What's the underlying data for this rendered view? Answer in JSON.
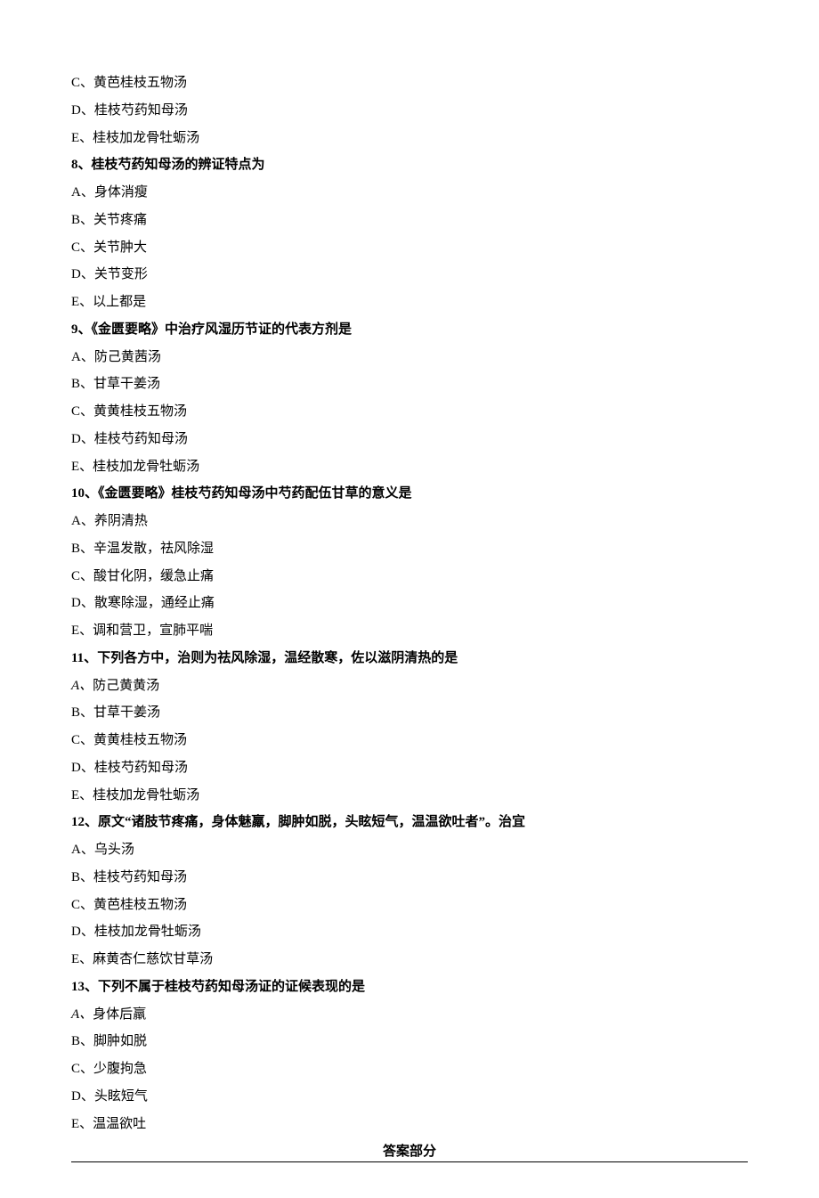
{
  "leading_options": [
    {
      "label": "C、",
      "text": "黄芭桂枝五物汤"
    },
    {
      "label": "D、",
      "text": "桂枝芍药知母汤"
    },
    {
      "label": "E、",
      "text": "桂枝加龙骨牡蛎汤"
    }
  ],
  "questions": [
    {
      "number": "8、",
      "stem": "桂枝芍药知母汤的辨证特点为",
      "options": [
        {
          "label": "A、",
          "text": "身体消瘦"
        },
        {
          "label": "B、",
          "text": "关节疼痛"
        },
        {
          "label": "C、",
          "text": "关节肿大"
        },
        {
          "label": "D、",
          "text": "关节变形"
        },
        {
          "label": "E、",
          "text": "以上都是"
        }
      ]
    },
    {
      "number": "9、",
      "stem": "《金匮要略》中治疗风湿历节证的代表方剂是",
      "options": [
        {
          "label": "A、",
          "text": "防己黄茜汤"
        },
        {
          "label": "B、",
          "text": "甘草干姜汤"
        },
        {
          "label": "C、",
          "text": "黄黄桂枝五物汤"
        },
        {
          "label": "D、",
          "text": "桂枝芍药知母汤"
        },
        {
          "label": "E、",
          "text": "桂枝加龙骨牡蛎汤"
        }
      ]
    },
    {
      "number": "10、",
      "stem": "《金匮要略》桂枝芍药知母汤中芍药配伍甘草的意义是",
      "options": [
        {
          "label": "A、",
          "text": "养阴清热"
        },
        {
          "label": "B、",
          "text": "辛温发散，祛风除湿"
        },
        {
          "label": "C、",
          "text": "酸甘化阴，缓急止痛"
        },
        {
          "label": "D、",
          "text": "散寒除湿，通经止痛"
        },
        {
          "label": "E、",
          "text": "调和营卫，宣肺平喘"
        }
      ]
    },
    {
      "number": "11、",
      "stem": "下列各方中，治则为祛风除湿，温经散寒，佐以滋阴清热的是",
      "options": [
        {
          "label": "A、",
          "text": "防己黄黄汤",
          "italic_label": true
        },
        {
          "label": "B、",
          "text": "甘草干姜汤"
        },
        {
          "label": "C、",
          "text": "黄黄桂枝五物汤"
        },
        {
          "label": "D、",
          "text": "桂枝芍药知母汤"
        },
        {
          "label": "E、",
          "text": "桂枝加龙骨牡蛎汤"
        }
      ]
    },
    {
      "number": "12、",
      "stem": "原文“诸肢节疼痛，身体魅羸，脚肿如脱，头眩短气，温温欲吐者”。治宜",
      "options": [
        {
          "label": "A、",
          "text": "乌头汤"
        },
        {
          "label": "B、",
          "text": "桂枝芍药知母汤"
        },
        {
          "label": "C、",
          "text": "黄芭桂枝五物汤"
        },
        {
          "label": "D、",
          "text": "桂枝加龙骨牡蛎汤"
        },
        {
          "label": "E、",
          "text": "麻黄杏仁慈饮甘草汤"
        }
      ]
    },
    {
      "number": "13、",
      "stem": "下列不属于桂枝芍药知母汤证的证候表现的是",
      "options": [
        {
          "label": "A、",
          "text": "身体后羸",
          "italic_label": true
        },
        {
          "label": "B、",
          "text": "脚肿如脱"
        },
        {
          "label": "C、",
          "text": "少腹拘急"
        },
        {
          "label": "D、",
          "text": "头眩短气"
        },
        {
          "label": "E、",
          "text": "温温欲吐"
        }
      ]
    }
  ],
  "answer_section": "答案部分"
}
